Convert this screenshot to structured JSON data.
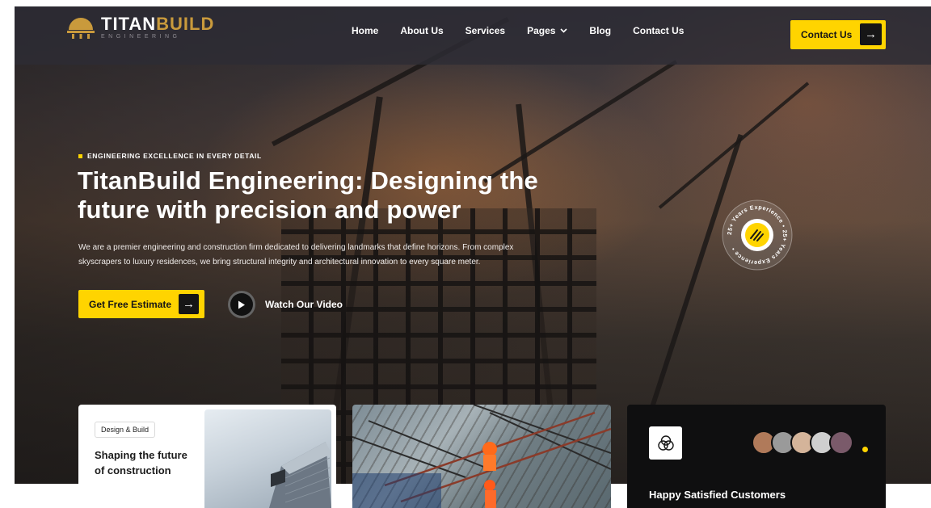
{
  "brand": {
    "name_part1": "TITAN",
    "name_part2": "BUILD",
    "tagline": "ENGINEERING",
    "accent_color": "#ffd400",
    "gold_color": "#c99a3c"
  },
  "nav": {
    "items": [
      {
        "label": "Home"
      },
      {
        "label": "About Us"
      },
      {
        "label": "Services"
      },
      {
        "label": "Pages",
        "has_dropdown": true
      },
      {
        "label": "Blog"
      },
      {
        "label": "Contact Us"
      }
    ],
    "cta_label": "Contact Us"
  },
  "hero": {
    "eyebrow": "ENGINEERING EXCELLENCE IN EVERY DETAIL",
    "headline_line1": "TitanBuild Engineering: Designing the",
    "headline_line2": "future with precision and power",
    "description_line1": "We are a premier engineering and construction firm dedicated to delivering landmarks that define horizons. From complex",
    "description_line2": "skyscrapers to luxury residences, we bring structural integrity and architectural innovation to every square meter.",
    "primary_cta": "Get Free Estimate",
    "video_label": "Watch Our Video",
    "badge_text": "25+ Years Experience • 25+ Years Experience •"
  },
  "cards": {
    "design": {
      "tag": "Design & Build",
      "title": "Shaping the future of construction"
    },
    "customers": {
      "title": "Happy Satisfied Customers"
    }
  },
  "icons": {
    "arrow": "arrow-right-icon",
    "play": "play-icon",
    "dropdown": "chevron-down-icon",
    "card3_icon": "venn-circles-icon"
  }
}
